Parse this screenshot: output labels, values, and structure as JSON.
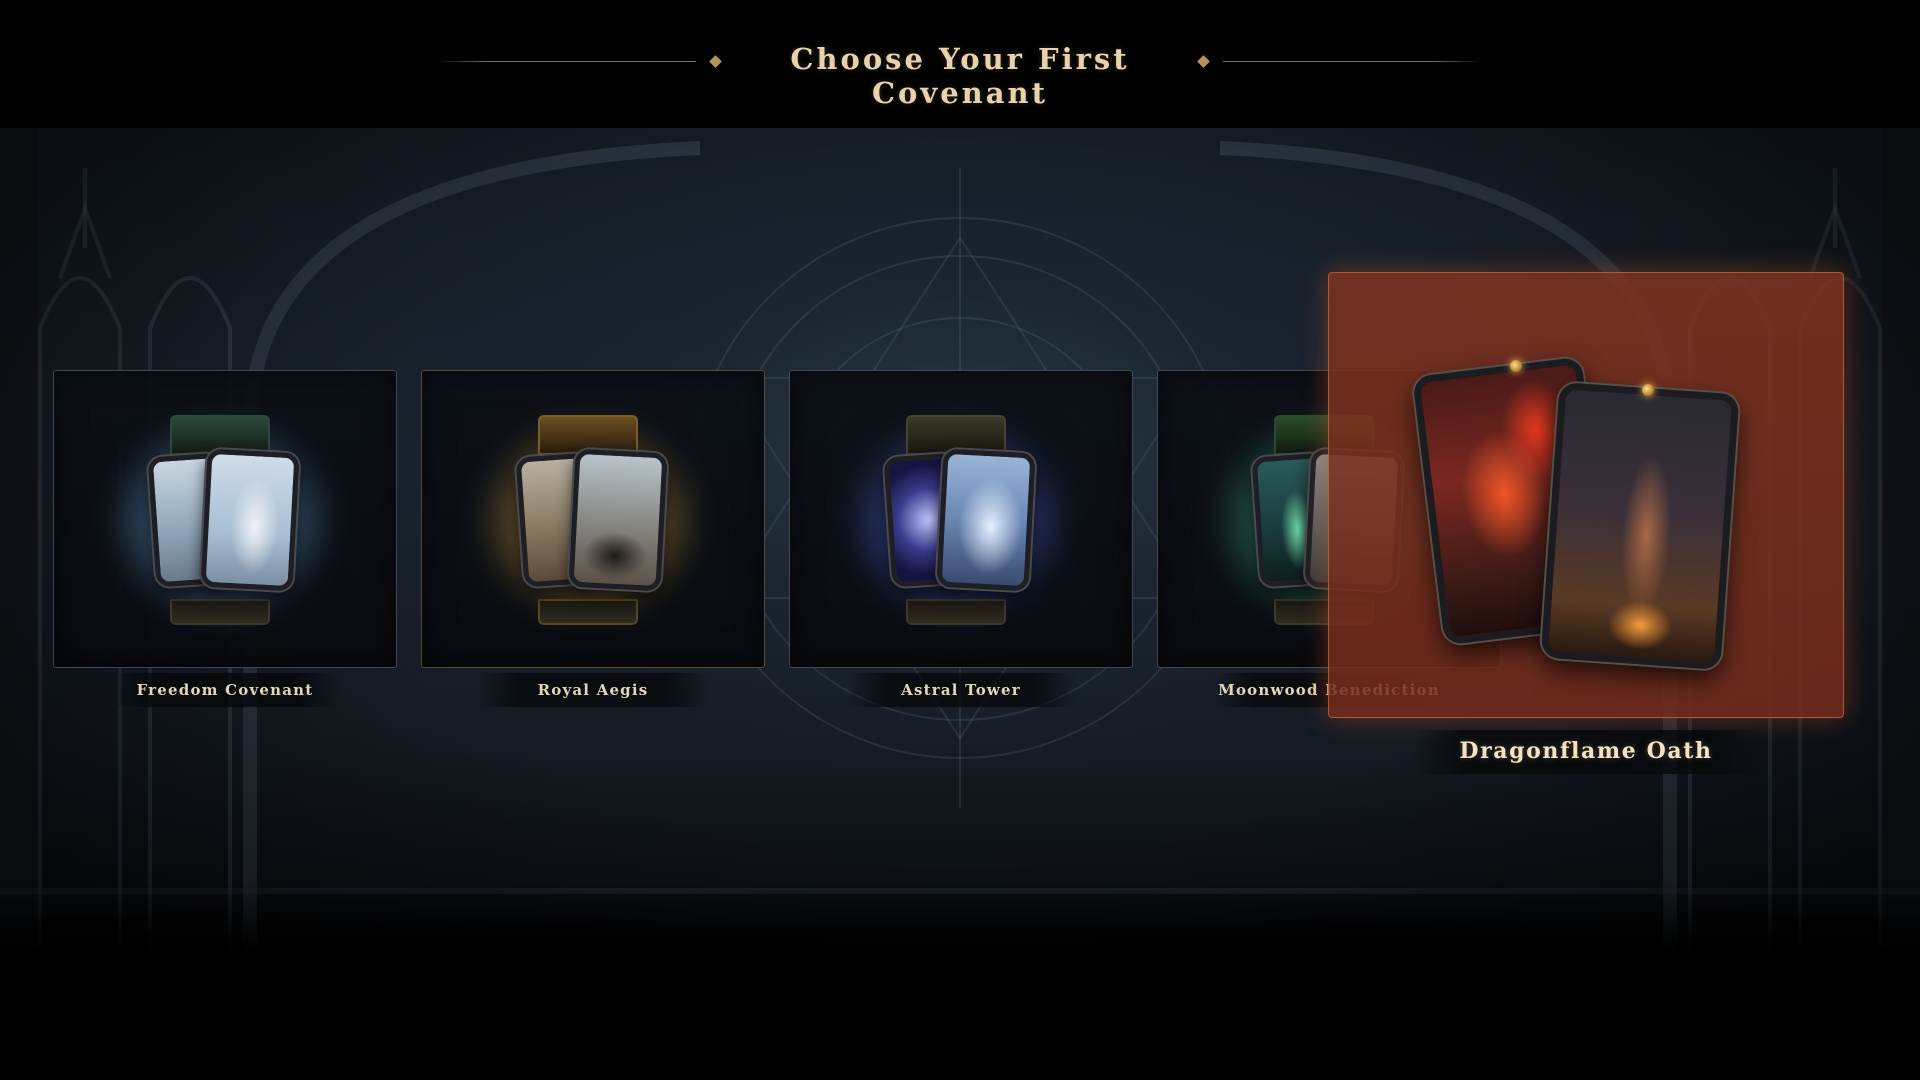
{
  "header": {
    "title": "Choose Your First Covenant"
  },
  "covenants": [
    {
      "label": "Freedom Covenant",
      "icon": "card-pack-icon",
      "theme": "#8fb4d8",
      "selected": false
    },
    {
      "label": "Royal Aegis",
      "icon": "card-pack-icon",
      "theme": "#c9a45a",
      "selected": false
    },
    {
      "label": "Astral Tower",
      "icon": "card-pack-icon",
      "theme": "#7a8ee0",
      "selected": false
    },
    {
      "label": "Moonwood Benediction",
      "icon": "card-pack-icon",
      "theme": "#6fbf9a",
      "selected": false
    },
    {
      "label": "Dragonflame Oath",
      "icon": "card-pack-icon",
      "theme": "#e0542a",
      "selected": true
    }
  ],
  "colors": {
    "title_text": "#e6d3ae",
    "selected_highlight": "#7a2e1c",
    "card_border": "#6e7887"
  }
}
